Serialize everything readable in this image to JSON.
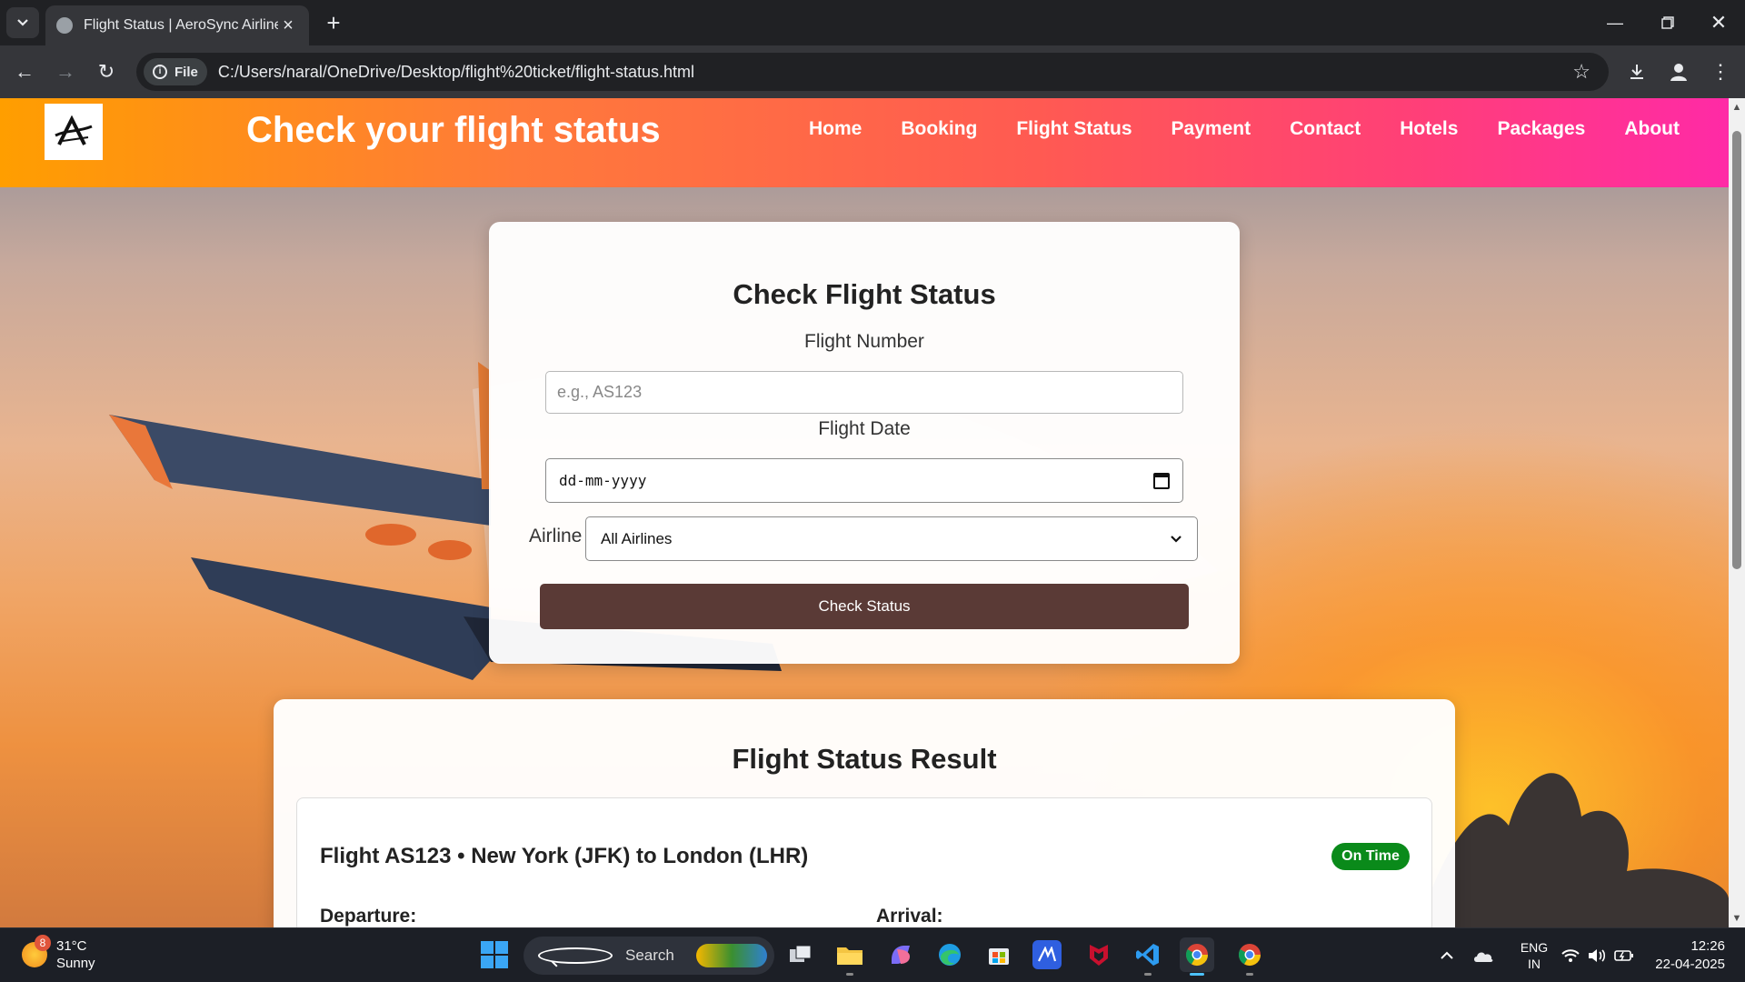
{
  "browser": {
    "tab_title": "Flight Status | AeroSync Airlines",
    "file_chip": "File",
    "url": "C:/Users/naral/OneDrive/Desktop/flight%20ticket/flight-status.html",
    "icons": [
      "tab-list-icon",
      "close-icon",
      "new-tab-icon",
      "back-icon",
      "forward-icon",
      "reload-icon",
      "info-icon",
      "star-icon",
      "download-icon",
      "profile-icon",
      "menu-icon",
      "minimize-icon",
      "restore-icon",
      "window-close-icon"
    ]
  },
  "header": {
    "title": "Check your flight status",
    "nav": [
      "Home",
      "Booking",
      "Flight Status",
      "Payment",
      "Contact",
      "Hotels",
      "Packages",
      "About"
    ],
    "colors": {
      "gradient_start": "#ff9e00",
      "gradient_end": "#ff2aa6"
    }
  },
  "form": {
    "heading": "Check Flight Status",
    "flight_number_label": "Flight Number",
    "flight_number_placeholder": "e.g., AS123",
    "flight_date_label": "Flight Date",
    "flight_date_value": "dd-mm-yyyy",
    "airline_label": "Airline",
    "airline_selected": "All Airlines",
    "submit_label": "Check Status",
    "button_color": "#5a3a36"
  },
  "result": {
    "heading": "Flight Status Result",
    "flight_title": "Flight AS123 • New York (JFK) to London (LHR)",
    "status": "On Time",
    "status_color": "#0a8a1a",
    "departure_label": "Departure:",
    "arrival_label": "Arrival:"
  },
  "taskbar": {
    "weather_temp": "31°C",
    "weather_desc": "Sunny",
    "weather_badge": "8",
    "search_label": "Search",
    "lang_line1": "ENG",
    "lang_line2": "IN",
    "time": "12:26",
    "date": "22-04-2025"
  }
}
